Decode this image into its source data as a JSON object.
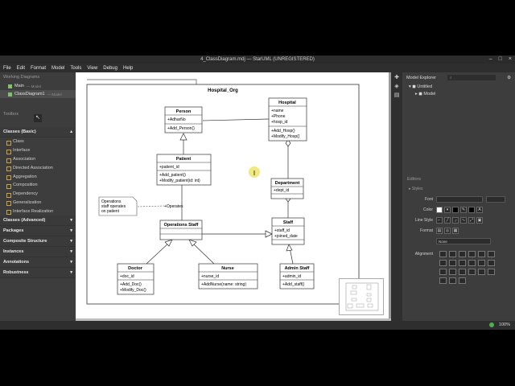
{
  "window": {
    "title": "4_ClassDiagram.mdj — StarUML (UNREGISTERED)"
  },
  "menu": [
    "File",
    "Edit",
    "Format",
    "Model",
    "Tools",
    "View",
    "Debug",
    "Help"
  ],
  "working_diagrams": {
    "title": "Working Diagrams",
    "items": [
      {
        "label": "Main",
        "sub": "— Model"
      },
      {
        "label": "ClassDiagram1",
        "sub": "— Model"
      }
    ]
  },
  "toolbox": {
    "title": "Toolbox",
    "groups": [
      {
        "label": "Classes (Basic)",
        "expanded": true,
        "tools": [
          "Class",
          "Interface",
          "Association",
          "Directed Association",
          "Aggregation",
          "Composition",
          "Dependency",
          "Generalization",
          "Interface Realization"
        ]
      },
      {
        "label": "Classes (Advanced)"
      },
      {
        "label": "Packages"
      },
      {
        "label": "Composite Structure"
      },
      {
        "label": "Instances"
      },
      {
        "label": "Annotations"
      },
      {
        "label": "Robustness"
      }
    ]
  },
  "diagram": {
    "frame_title": "Hospital_Org",
    "note": [
      "Operations",
      "staff operates",
      "on patient"
    ],
    "operates_label": "+Operates",
    "classes": {
      "person": {
        "name": "Person",
        "attrs": [
          "+AdharNo"
        ],
        "ops": [
          "+Add_Person()"
        ]
      },
      "hospital": {
        "name": "Hospital",
        "attrs": [
          "+name",
          "+Phone",
          "+hosp_id"
        ],
        "ops": [
          "+Add_Hosp()",
          "+Modify_Hosp()"
        ]
      },
      "patient": {
        "name": "Patient",
        "attrs": [
          "+patient_id"
        ],
        "ops": [
          "+Add_patient()",
          "+Modify_patient(id: int)"
        ]
      },
      "department": {
        "name": "Department",
        "attrs": [
          "+dept_id"
        ],
        "ops": []
      },
      "ops_staff": {
        "name": "Operations Staff",
        "attrs": [],
        "ops": []
      },
      "staff": {
        "name": "Staff",
        "attrs": [
          "+staff_id",
          "+joined_date"
        ],
        "ops": []
      },
      "doctor": {
        "name": "Doctor",
        "attrs": [
          "+doc_id"
        ],
        "ops": [
          "+Add_Doc()",
          "+Modify_Doc()"
        ]
      },
      "nurse": {
        "name": "Nurse",
        "attrs": [
          "+nurse_id"
        ],
        "ops": [
          "+AddNurse(name: string)"
        ]
      },
      "admin": {
        "name": "Admin Staff",
        "attrs": [
          "+admin_id"
        ],
        "ops": [
          "+Add_staff()"
        ]
      }
    }
  },
  "model_explorer": {
    "title": "Model Explorer",
    "items": [
      "Untitled",
      "Model"
    ]
  },
  "editors": {
    "title": "Editors",
    "styles_label": "Styles",
    "font_label": "Font",
    "color_label": "Color",
    "line_style_label": "Line Style",
    "format_label": "Format",
    "format_value": "None",
    "alignment_label": "Alignment",
    "colors": {
      "fill": "#ffffff",
      "line": "#000000",
      "font": "#000000"
    }
  },
  "status": {
    "zoom": "100%"
  }
}
